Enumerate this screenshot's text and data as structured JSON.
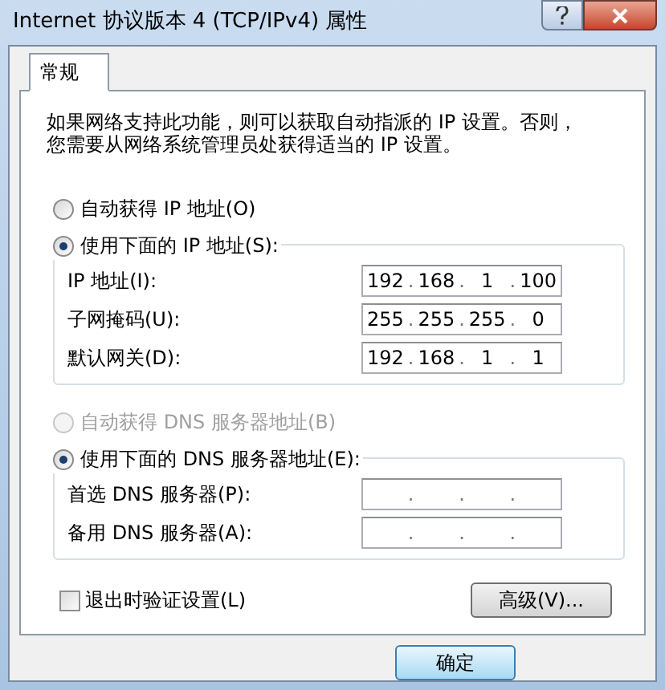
{
  "window": {
    "title": "Internet 协议版本 4 (TCP/IPv4) 属性"
  },
  "tabs": [
    {
      "label": "常规",
      "selected": true
    }
  ],
  "description": "如果网络支持此功能，则可以获取自动指派的 IP 设置。否则，您需要从网络系统管理员处获得适当的 IP 设置。",
  "ip_mode": [
    {
      "label": "自动获得 IP 地址(O)",
      "selected": false,
      "disabled": false
    },
    {
      "label": "使用下面的 IP 地址(S):",
      "selected": true,
      "disabled": false
    }
  ],
  "ip_fields": [
    {
      "label": "IP 地址(I):",
      "separator": ".",
      "octets": [
        "192",
        "168",
        "1",
        "100"
      ]
    },
    {
      "label": "子网掩码(U):",
      "separator": ".",
      "octets": [
        "255",
        "255",
        "255",
        "0"
      ]
    },
    {
      "label": "默认网关(D):",
      "separator": ".",
      "octets": [
        "192",
        "168",
        "1",
        "1"
      ]
    }
  ],
  "dns_mode": [
    {
      "label": "自动获得 DNS 服务器地址(B)",
      "selected": false,
      "disabled": true
    },
    {
      "label": "使用下面的 DNS 服务器地址(E):",
      "selected": true,
      "disabled": false
    }
  ],
  "dns_fields": [
    {
      "label": "首选 DNS 服务器(P):",
      "separator": "."
    },
    {
      "label": "备用 DNS 服务器(A):",
      "separator": "."
    }
  ],
  "validate_on_exit": {
    "label": "退出时验证设置(L)",
    "checked": false
  },
  "advanced_button": "高级(V)...",
  "ok_button": "确定"
}
